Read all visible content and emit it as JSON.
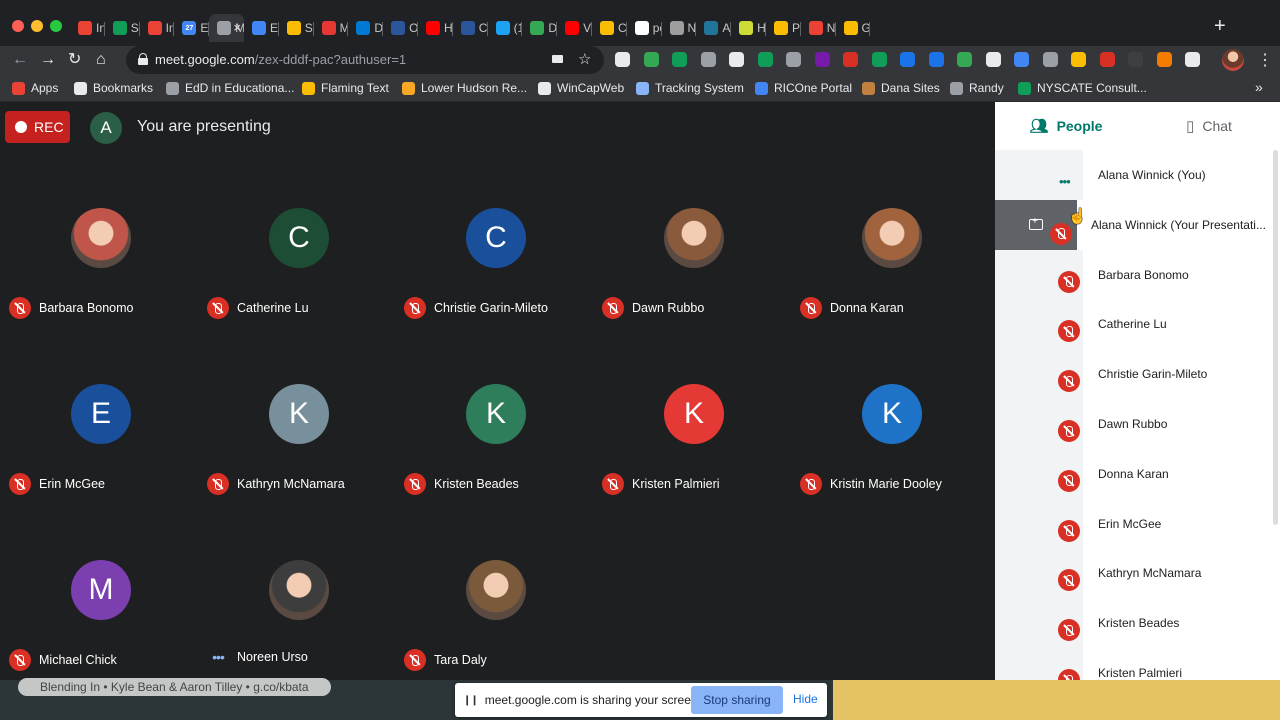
{
  "browser": {
    "tabs": [
      {
        "label": "Inb",
        "icon": "gmail-icon",
        "color": "#ea4335"
      },
      {
        "label": "Sc",
        "icon": "sheets-icon",
        "color": "#0f9d58"
      },
      {
        "label": "Inb",
        "icon": "gmail-icon",
        "color": "#ea4335"
      },
      {
        "label": "Ea",
        "icon": "calendar-icon",
        "color": "#4285f4",
        "badge": "27"
      },
      {
        "label": "M",
        "icon": "meet-recording-icon",
        "color": "#9aa0a6",
        "active": true
      },
      {
        "label": "Ea",
        "icon": "docs-icon",
        "color": "#4285f4"
      },
      {
        "label": "Se",
        "icon": "drive-icon",
        "color": "#fbbc04"
      },
      {
        "label": "Mi",
        "icon": "opera-icon",
        "color": "#e53935"
      },
      {
        "label": "Do",
        "icon": "onedrive-icon",
        "color": "#0078d4"
      },
      {
        "label": "On",
        "icon": "word-icon",
        "color": "#2b579a"
      },
      {
        "label": "Ho",
        "icon": "youtube-icon",
        "color": "#ff0000"
      },
      {
        "label": "CC",
        "icon": "word-icon",
        "color": "#2b579a"
      },
      {
        "label": "(11",
        "icon": "twitter-icon",
        "color": "#1da1f2"
      },
      {
        "label": "DF",
        "icon": "lock-icon",
        "color": "#34a853"
      },
      {
        "label": "Vic",
        "icon": "youtube-icon",
        "color": "#ff0000"
      },
      {
        "label": "CC",
        "icon": "smiley-icon",
        "color": "#fbbc04"
      },
      {
        "label": "pe",
        "icon": "google-icon",
        "color": "#ffffff"
      },
      {
        "label": "Ne",
        "icon": "news-icon",
        "color": "#9e9e9e"
      },
      {
        "label": "Ap",
        "icon": "wordpress-icon",
        "color": "#21759b"
      },
      {
        "label": "He",
        "icon": "bulb-icon",
        "color": "#cddc39"
      },
      {
        "label": "Pe",
        "icon": "notes-icon",
        "color": "#fbbc04"
      },
      {
        "label": "Ne",
        "icon": "news-icon",
        "color": "#ea4335"
      },
      {
        "label": "Go",
        "icon": "drive-icon",
        "color": "#fbbc04"
      }
    ],
    "url_host": "meet.google.com",
    "url_path": "/zex-dddf-pac?authuser=1",
    "bookmarks": [
      {
        "label": "Apps",
        "color": "#ea4335"
      },
      {
        "label": "Bookmarks",
        "color": "#e8eaed"
      },
      {
        "label": "EdD in Educationa...",
        "color": "#9aa0a6"
      },
      {
        "label": "Flaming Text",
        "color": "#fbbc04"
      },
      {
        "label": "Lower Hudson Re...",
        "color": "#f9a825"
      },
      {
        "label": "WinCapWeb",
        "color": "#e8eaed"
      },
      {
        "label": "Tracking System",
        "color": "#8ab4f8"
      },
      {
        "label": "RICOne Portal",
        "color": "#4285f4"
      },
      {
        "label": "Dana Sites",
        "color": "#bf8040"
      },
      {
        "label": "Randy",
        "color": "#9aa0a6"
      },
      {
        "label": "NYSCATE Consult...",
        "color": "#0f9d58"
      }
    ]
  },
  "meet": {
    "rec_label": "REC",
    "presenter_initial": "A",
    "presenting_text": "You are presenting",
    "tiles": [
      {
        "name": "Barbara Bonomo",
        "photo": true,
        "color": "#c0554a",
        "status": "muted"
      },
      {
        "name": "Catherine Lu",
        "initial": "C",
        "color": "#1e4d36",
        "status": "muted"
      },
      {
        "name": "Christie Garin-Mileto",
        "initial": "C",
        "color": "#1a4f9c",
        "status": "muted"
      },
      {
        "name": "Dawn Rubbo",
        "photo": true,
        "color": "#8a5a3c",
        "status": "muted"
      },
      {
        "name": "Donna Karan",
        "photo": true,
        "color": "#a0633e",
        "status": "muted"
      },
      {
        "name": "Erin McGee",
        "initial": "E",
        "color": "#1a4f9c",
        "status": "muted"
      },
      {
        "name": "Kathryn McNamara",
        "initial": "K",
        "color": "#78909c",
        "status": "muted"
      },
      {
        "name": "Kristen Beades",
        "initial": "K",
        "color": "#2e7d5b",
        "status": "muted"
      },
      {
        "name": "Kristen Palmieri",
        "initial": "K",
        "color": "#e53935",
        "status": "muted"
      },
      {
        "name": "Kristin Marie Dooley",
        "initial": "K",
        "color": "#1e73c8",
        "status": "muted"
      },
      {
        "name": "Michael Chick",
        "initial": "M",
        "color": "#7b3fb0",
        "status": "muted"
      },
      {
        "name": "Noreen Urso",
        "photo": true,
        "color": "#3d3d3d",
        "status": "speaking"
      },
      {
        "name": "Tara Daly",
        "photo": true,
        "color": "#7a5a3a",
        "status": "muted"
      }
    ]
  },
  "panel": {
    "tab_people": "People",
    "tab_chat": "Chat",
    "people": [
      {
        "name": "Alana Winnick (You)",
        "status": "dots"
      },
      {
        "name": "Alana Winnick (Your Presentati...",
        "status": "present"
      },
      {
        "name": "Barbara Bonomo",
        "status": "muted"
      },
      {
        "name": "Catherine Lu",
        "status": "muted"
      },
      {
        "name": "Christie Garin-Mileto",
        "status": "muted"
      },
      {
        "name": "Dawn Rubbo",
        "status": "muted"
      },
      {
        "name": "Donna Karan",
        "status": "muted"
      },
      {
        "name": "Erin McGee",
        "status": "muted"
      },
      {
        "name": "Kathryn McNamara",
        "status": "muted"
      },
      {
        "name": "Kristen Beades",
        "status": "muted"
      },
      {
        "name": "Kristen Palmieri",
        "status": "muted"
      }
    ]
  },
  "bottom": {
    "caption": "Blending In  •  Kyle Bean & Aaron Tilley  •  g.co/kbata",
    "share_text": "meet.google.com is sharing your screen.",
    "stop_label": "Stop sharing",
    "hide_label": "Hide"
  }
}
